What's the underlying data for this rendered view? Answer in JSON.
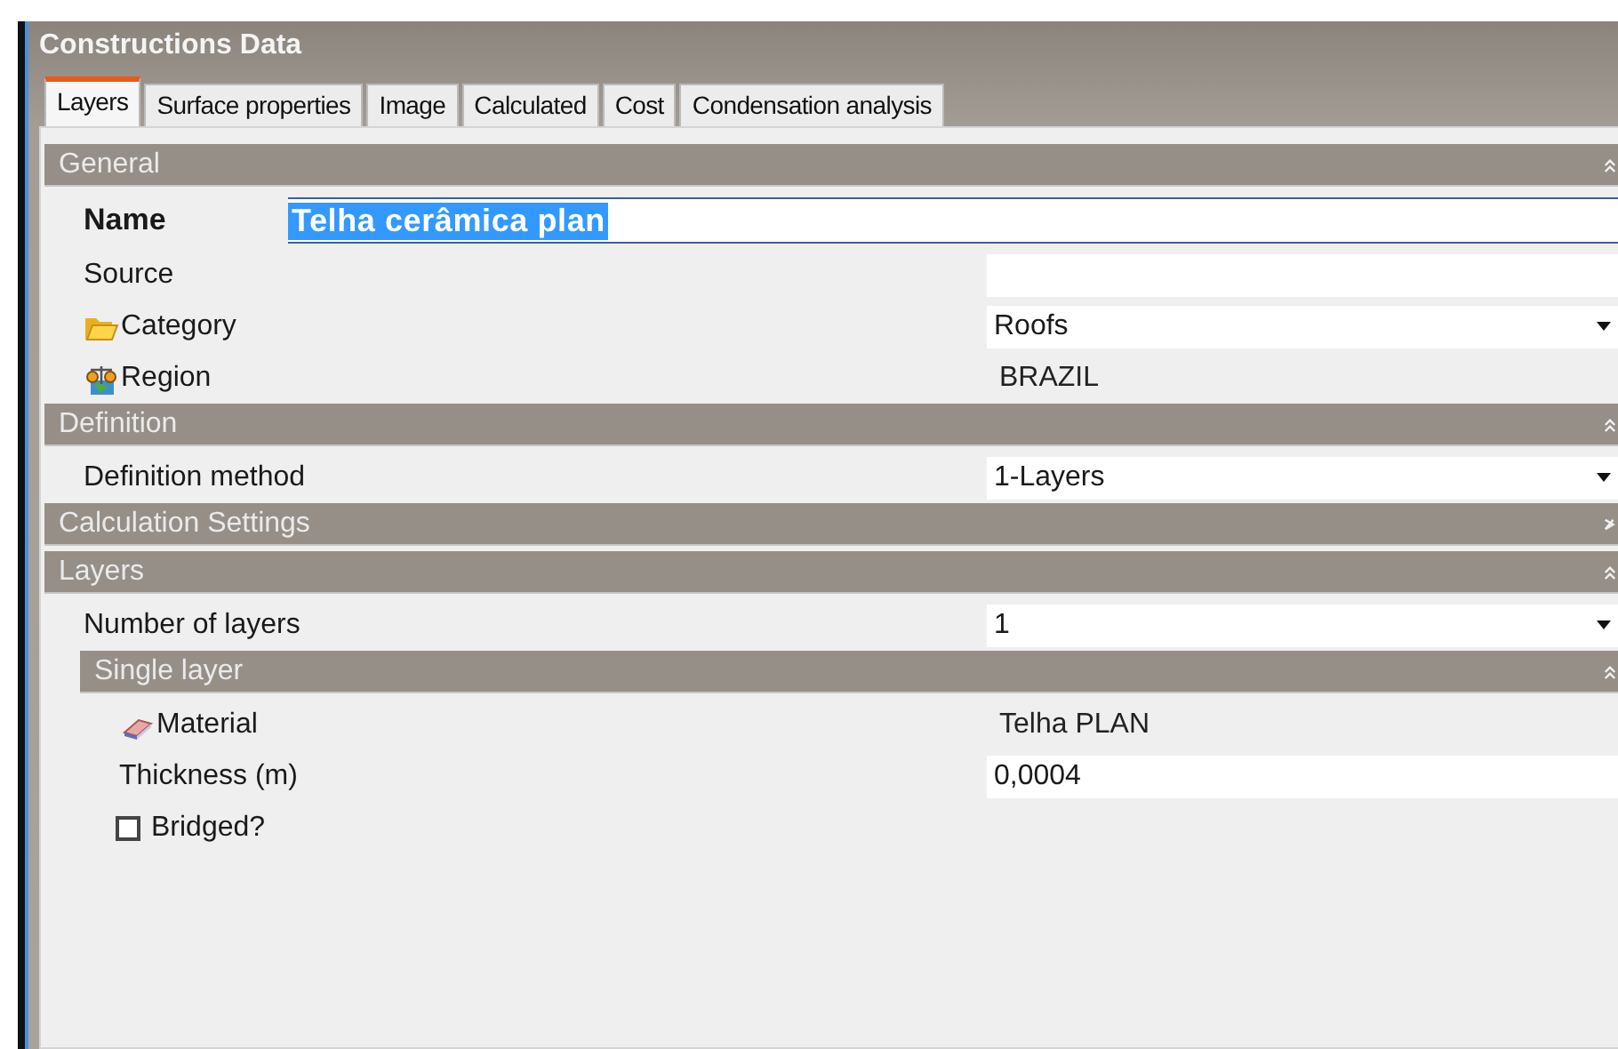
{
  "window": {
    "title": "Constructions Data"
  },
  "tabs": [
    {
      "label": "Layers",
      "selected": true
    },
    {
      "label": "Surface properties",
      "selected": false
    },
    {
      "label": "Image",
      "selected": false
    },
    {
      "label": "Calculated",
      "selected": false
    },
    {
      "label": "Cost",
      "selected": false
    },
    {
      "label": "Condensation analysis",
      "selected": false
    }
  ],
  "sections": [
    {
      "title": "General",
      "expanded": true,
      "rows": [
        {
          "kind": "name",
          "label": "Name",
          "value": "Telha cerâmica plan"
        },
        {
          "kind": "field",
          "label": "Source"
        },
        {
          "kind": "dropdown",
          "label": "Category",
          "value": "Roofs"
        },
        {
          "kind": "text",
          "label": "Region",
          "value": "BRAZIL"
        }
      ]
    },
    {
      "title": "Definition",
      "expanded": true,
      "rows": [
        {
          "kind": "dropdown",
          "label": "Definition method",
          "value": "1-Layers"
        }
      ]
    },
    {
      "title": "Calculation Settings",
      "expanded": false
    },
    {
      "title": "Layers",
      "expanded": true,
      "rows": [
        {
          "kind": "dropdown",
          "label": "Number of layers",
          "value": "1"
        },
        {
          "kind": "group",
          "title": "Single layer",
          "expanded": true,
          "rows": [
            {
              "kind": "text",
              "label": "Material",
              "value": "Telha PLAN"
            },
            {
              "kind": "field",
              "label": "Thickness (m)",
              "value": "0,0004"
            },
            {
              "kind": "checkbox",
              "label": "Bridged?",
              "checked": false
            }
          ]
        }
      ]
    }
  ]
}
